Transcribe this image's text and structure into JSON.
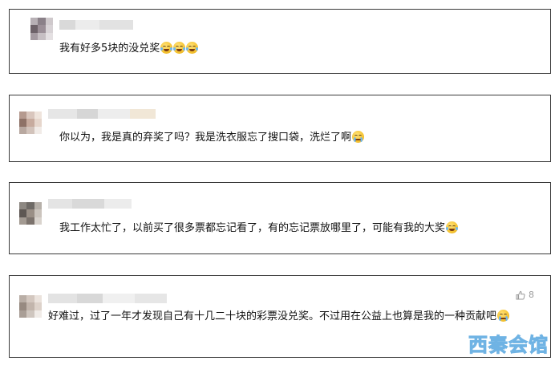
{
  "comments": [
    {
      "text": "我有好多5块的没兑奖",
      "emojis": [
        "cry-laugh-emoji",
        "cry-laugh-emoji",
        "cry-laugh-emoji"
      ]
    },
    {
      "text": "你以为，我是真的弃奖了吗？我是洗衣服忘了搜口袋，洗烂了啊",
      "emojis": [
        "crying-emoji"
      ]
    },
    {
      "text": "我工作太忙了，以前买了很多票都忘记看了，有的忘记票放哪里了，可能有我的大奖",
      "emojis": [
        "cry-laugh-emoji"
      ]
    },
    {
      "text": "好难过，过了一年才发现自己有十几二十块的彩票没兑奖。不过用在公益上也算是我的一种贡献吧",
      "emojis": [
        "crying-emoji"
      ],
      "like_count": "8"
    }
  ],
  "watermark": "西秦会馆",
  "colors": {
    "border": "#3a3a3a",
    "text": "#111111",
    "like": "#9a9a9a",
    "watermark_fill": "#bfe0f7",
    "watermark_stroke": "#6fb3e4"
  }
}
